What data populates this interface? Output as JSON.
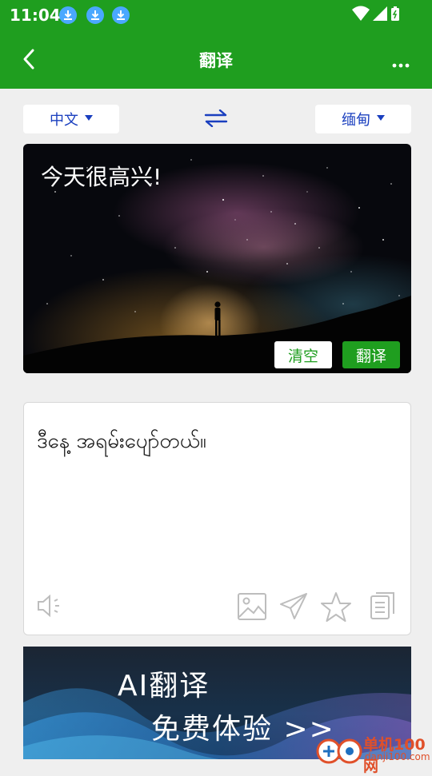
{
  "status": {
    "time": "11:04"
  },
  "header": {
    "title": "翻译"
  },
  "languages": {
    "source": "中文",
    "target": "缅甸"
  },
  "input": {
    "text": "今天很高兴!"
  },
  "input_actions": {
    "clear": "清空",
    "translate": "翻译"
  },
  "output": {
    "text": "ဒီနေ့ အရမ်းပျော်တယ်။"
  },
  "banner": {
    "line1": "AI翻译",
    "line2": "免费体验 >>"
  },
  "watermark": {
    "brand": "单机100网",
    "domain": "danji100.com"
  },
  "colors": {
    "primary": "#1f9e1f",
    "lang_text": "#1a3fbf",
    "download_badge": "#4aa8ff"
  },
  "icons": [
    "back-arrow-icon",
    "more-icon",
    "swap-icon",
    "speaker-icon",
    "image-icon",
    "send-icon",
    "star-icon",
    "copy-icon",
    "wifi-icon",
    "battery-icon",
    "download-icon"
  ]
}
